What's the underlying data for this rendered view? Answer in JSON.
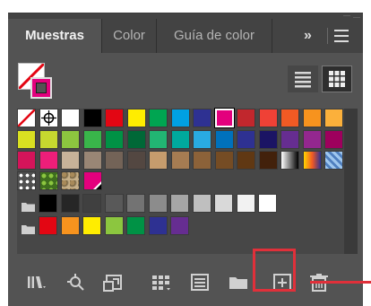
{
  "tabs": [
    {
      "label": "Muestras",
      "active": true
    },
    {
      "label": "Color",
      "active": false
    },
    {
      "label": "Guía de color",
      "active": false
    }
  ],
  "tab_icons": {
    "overflow": "»",
    "menu": "menu-icon"
  },
  "fill_stroke": {
    "fill": "none",
    "stroke": "#E3007D"
  },
  "view_buttons": [
    {
      "name": "list-view-icon",
      "active": false
    },
    {
      "name": "grid-view-icon",
      "active": true
    }
  ],
  "swatch_rows": [
    {
      "folder": false,
      "swatches": [
        "none",
        "registration",
        "#FFFFFF",
        "#000000",
        "#E30613",
        "#FFED00",
        "#00A551",
        "#00A0E3",
        "#2E3192",
        "#E3007D",
        "#C1272D",
        "#EF4136",
        "#F15A24",
        "#F7931E",
        "#FBB03B"
      ]
    },
    {
      "folder": false,
      "swatches": [
        "#D9E021",
        "#C6D82F",
        "#8CC63F",
        "#39B54A",
        "#009245",
        "#006837",
        "#22B573",
        "#00A99D",
        "#29ABE2",
        "#0071BC",
        "#2E3192",
        "#1B1464",
        "#662D91",
        "#93278F",
        "#9E005D"
      ]
    },
    {
      "folder": false,
      "swatches": [
        "#D4145A",
        "#ED1E79",
        "#C7B299",
        "#998675",
        "#736357",
        "#534741",
        "#C69C6D",
        "#A67C52",
        "#8C6239",
        "#754C24",
        "#603813",
        "#42210B",
        "gradient-bw",
        "gradient-orange",
        "pattern-blue"
      ]
    },
    {
      "folder": false,
      "swatches": [
        "pattern-dots",
        "pattern-leaves",
        "pattern-camo",
        "#E3007D"
      ]
    },
    {
      "folder": true,
      "swatches": [
        "#000000",
        "#262626",
        "#404040",
        "#595959",
        "#737373",
        "#8C8C8C",
        "#A6A6A6",
        "#BFBFBF",
        "#D9D9D9",
        "#F2F2F2",
        "#FFFFFF"
      ]
    },
    {
      "folder": true,
      "swatches": [
        "#E30613",
        "#F7931E",
        "#FFED00",
        "#8CC63F",
        "#009245",
        "#2E3192",
        "#662D91"
      ]
    }
  ],
  "selected_swatch": "#E3007D",
  "bottom_icons": [
    "libraries-icon",
    "swatch-kind-icon",
    "place-swatches-icon",
    "swatch-options-icon",
    "color-group-icon",
    "new-color-group-icon",
    "new-swatch-icon",
    "delete-icon"
  ],
  "annotation_color": "#E0303A"
}
